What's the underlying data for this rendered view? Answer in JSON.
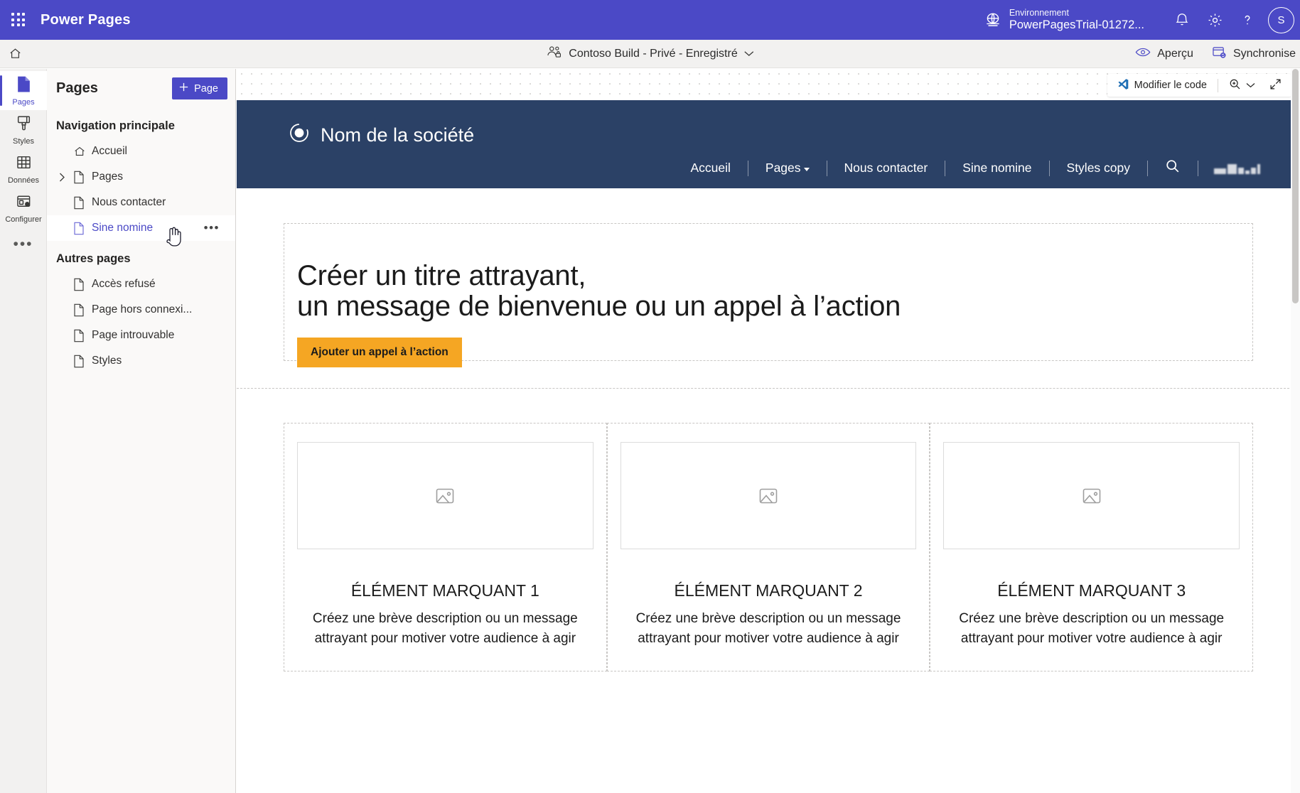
{
  "topbar": {
    "waffle_icon": "app-launcher-icon",
    "app_title": "Power Pages",
    "environment_label": "Environnement",
    "environment_value": "PowerPagesTrial-01272...",
    "globe_icon": "globe-icon",
    "notification_icon": "bell-icon",
    "settings_icon": "gear-icon",
    "help_icon": "question-mark-icon",
    "avatar_initial": "S",
    "accent_color": "#4B49C6"
  },
  "commandbar": {
    "home_icon": "home-icon",
    "site_name": "Contoso Build - Privé - Enregistré",
    "site_icon": "people-lock-icon",
    "chevron_icon": "chevron-down-icon",
    "preview_label": "Aperçu",
    "preview_icon": "eye-icon",
    "sync_label": "Synchronise",
    "sync_icon": "sync-database-icon"
  },
  "rail": {
    "items": [
      {
        "label": "Pages",
        "icon": "page-icon",
        "active": true
      },
      {
        "label": "Styles",
        "icon": "paintbrush-icon",
        "active": false
      },
      {
        "label": "Données",
        "icon": "table-icon",
        "active": false
      },
      {
        "label": "Configurer",
        "icon": "settings-window-icon",
        "active": false
      }
    ],
    "overflow_label": "•••"
  },
  "panel": {
    "title": "Pages",
    "add_button_label": "Page",
    "add_button_icon": "plus-icon",
    "groups": [
      {
        "title": "Navigation principale",
        "items": [
          {
            "label": "Accueil",
            "icon": "home-outline-icon",
            "expandable": false,
            "selected": false
          },
          {
            "label": "Pages",
            "icon": "file-icon",
            "expandable": true,
            "selected": false
          },
          {
            "label": "Nous contacter",
            "icon": "file-icon",
            "expandable": false,
            "selected": false
          },
          {
            "label": "Sine nomine",
            "icon": "file-icon",
            "expandable": false,
            "selected": true,
            "more_label": "•••"
          }
        ]
      },
      {
        "title": "Autres pages",
        "items": [
          {
            "label": "Accès refusé",
            "icon": "file-icon",
            "expandable": false,
            "selected": false
          },
          {
            "label": "Page hors connexi...",
            "icon": "file-icon",
            "expandable": false,
            "selected": false
          },
          {
            "label": "Page introuvable",
            "icon": "file-icon",
            "expandable": false,
            "selected": false
          },
          {
            "label": "Styles",
            "icon": "file-icon",
            "expandable": false,
            "selected": false
          }
        ]
      }
    ]
  },
  "canvas_toolbar": {
    "edit_code_label": "Modifier le code",
    "edit_code_icon": "vscode-icon",
    "zoom_icon": "magnifier-plus-icon",
    "zoom_chevron_icon": "chevron-down-icon",
    "expand_icon": "expand-arrows-icon"
  },
  "site": {
    "header_color": "#2B4166",
    "brand_name": "Nom de la société",
    "brand_icon": "circle-logo-icon",
    "nav": [
      {
        "label": "Accueil",
        "dropdown": false
      },
      {
        "label": "Pages",
        "dropdown": true
      },
      {
        "label": "Nous contacter",
        "dropdown": false
      },
      {
        "label": "Sine nomine",
        "dropdown": false
      },
      {
        "label": "Styles copy",
        "dropdown": false
      }
    ],
    "search_icon": "search-icon",
    "redacted_item": "redacted-blurred-element",
    "hero": {
      "title_line1": "Créer un titre attrayant,",
      "title_line2": "un message de bienvenue ou un appel à l’action",
      "cta_label": "Ajouter un appel à l’action",
      "cta_color": "#F5A623"
    },
    "cards": [
      {
        "image_icon": "image-placeholder-icon",
        "title": "ÉLÉMENT MARQUANT 1",
        "description": "Créez une brève description ou un message attrayant pour motiver votre audience à agir"
      },
      {
        "image_icon": "image-placeholder-icon",
        "title": "ÉLÉMENT MARQUANT 2",
        "description": "Créez une brève description ou un message attrayant pour motiver votre audience à agir"
      },
      {
        "image_icon": "image-placeholder-icon",
        "title": "ÉLÉMENT MARQUANT 3",
        "description": "Créez une brève description ou un message attrayant pour motiver votre audience à agir"
      }
    ]
  }
}
